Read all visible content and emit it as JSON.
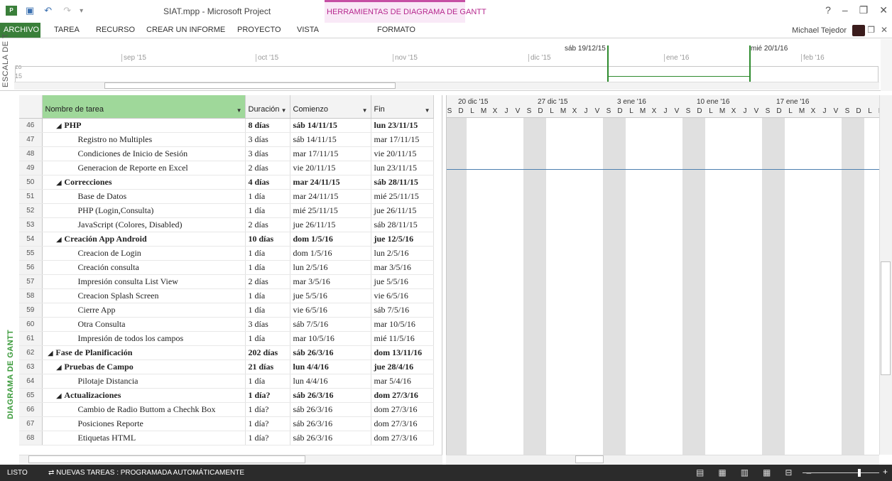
{
  "window": {
    "title": "SIAT.mpp - Microsoft Project",
    "context_tab": "HERRAMIENTAS DE DIAGRAMA DE GANTT",
    "user": "Michael Tejedor"
  },
  "ribbon": {
    "file": "ARCHIVO",
    "tabs": [
      "TAREA",
      "RECURSO",
      "CREAR UN INFORME",
      "PROYECTO",
      "VISTA",
      "FORMATO"
    ]
  },
  "timeline": {
    "side_label": "ESCALA DE T",
    "months": [
      "sep '15",
      "oct '15",
      "nov '15",
      "dic '15",
      "ene '16",
      "feb '16"
    ],
    "markers": [
      "sáb 19/12/15",
      "mié 20/1/16"
    ],
    "small": [
      "zo",
      "15"
    ]
  },
  "view_label": "DIAGRAMA DE GANTT",
  "columns": {
    "name": "Nombre de tarea",
    "duration": "Duración",
    "start": "Comienzo",
    "finish": "Fin"
  },
  "tasks": [
    {
      "id": "46",
      "name": "PHP",
      "dur": "8 días",
      "start": "sáb 14/11/15",
      "end": "lun 23/11/15",
      "summary": true,
      "level": 1
    },
    {
      "id": "47",
      "name": "Registro no Multiples",
      "dur": "3 días",
      "start": "sáb 14/11/15",
      "end": "mar 17/11/15",
      "level": 2
    },
    {
      "id": "48",
      "name": "Condiciones de Inicio de Sesión",
      "dur": "3 días",
      "start": "mar 17/11/15",
      "end": "vie 20/11/15",
      "level": 2
    },
    {
      "id": "49",
      "name": "Generacion de Reporte en Excel",
      "dur": "2 días",
      "start": "vie 20/11/15",
      "end": "lun 23/11/15",
      "level": 2
    },
    {
      "id": "50",
      "name": "Correcciones",
      "dur": "4 días",
      "start": "mar 24/11/15",
      "end": "sáb 28/11/15",
      "summary": true,
      "level": 1
    },
    {
      "id": "51",
      "name": "Base de Datos",
      "dur": "1 día",
      "start": "mar 24/11/15",
      "end": "mié 25/11/15",
      "level": 2
    },
    {
      "id": "52",
      "name": "PHP (Login,Consulta)",
      "dur": "1 día",
      "start": "mié 25/11/15",
      "end": "jue 26/11/15",
      "level": 2
    },
    {
      "id": "53",
      "name": "JavaScript (Colores, Disabled)",
      "dur": "2 días",
      "start": "jue 26/11/15",
      "end": "sáb 28/11/15",
      "level": 2
    },
    {
      "id": "54",
      "name": "Creación App Android",
      "dur": "10 días",
      "start": "dom 1/5/16",
      "end": "jue 12/5/16",
      "summary": true,
      "level": 1
    },
    {
      "id": "55",
      "name": "Creacion de Login",
      "dur": "1 día",
      "start": "dom 1/5/16",
      "end": "lun 2/5/16",
      "level": 2
    },
    {
      "id": "56",
      "name": "Creación consulta",
      "dur": "1 día",
      "start": "lun 2/5/16",
      "end": "mar 3/5/16",
      "level": 2
    },
    {
      "id": "57",
      "name": "Impresión consulta List View",
      "dur": "2 días",
      "start": "mar 3/5/16",
      "end": "jue 5/5/16",
      "level": 2
    },
    {
      "id": "58",
      "name": "Creacion Splash Screen",
      "dur": "1 día",
      "start": "jue 5/5/16",
      "end": "vie 6/5/16",
      "level": 2
    },
    {
      "id": "59",
      "name": "Cierre App",
      "dur": "1 día",
      "start": "vie 6/5/16",
      "end": "sáb 7/5/16",
      "level": 2
    },
    {
      "id": "60",
      "name": "Otra Consulta",
      "dur": "3 días",
      "start": "sáb 7/5/16",
      "end": "mar 10/5/16",
      "level": 2
    },
    {
      "id": "61",
      "name": "Impresión de todos los campos",
      "dur": "1 día",
      "start": "mar 10/5/16",
      "end": "mié 11/5/16",
      "level": 2
    },
    {
      "id": "62",
      "name": "Fase de Planificación",
      "dur": "202 días",
      "start": "sáb 26/3/16",
      "end": "dom 13/11/16",
      "summary": true,
      "level": 0
    },
    {
      "id": "63",
      "name": "Pruebas de Campo",
      "dur": "21 días",
      "start": "lun 4/4/16",
      "end": "jue 28/4/16",
      "summary": true,
      "level": 1
    },
    {
      "id": "64",
      "name": "Pilotaje Distancia",
      "dur": "1 día",
      "start": "lun 4/4/16",
      "end": "mar 5/4/16",
      "level": 2
    },
    {
      "id": "65",
      "name": "Actualizaciones",
      "dur": "1 día?",
      "start": "sáb 26/3/16",
      "end": "dom 27/3/16",
      "summary": true,
      "level": 1
    },
    {
      "id": "66",
      "name": "Cambio de Radio Buttom a Chechk Box",
      "dur": "1 día?",
      "start": "sáb 26/3/16",
      "end": "dom 27/3/16",
      "level": 2
    },
    {
      "id": "67",
      "name": "Posiciones Reporte",
      "dur": "1 día?",
      "start": "sáb 26/3/16",
      "end": "dom 27/3/16",
      "level": 2
    },
    {
      "id": "68",
      "name": "Etiquetas HTML",
      "dur": "1 día?",
      "start": "sáb 26/3/16",
      "end": "dom 27/3/16",
      "level": 2
    }
  ],
  "gantt": {
    "weeks": [
      "20 dic '15",
      "27 dic '15",
      "3 ene '16",
      "10 ene '16",
      "17 ene '16"
    ],
    "days": [
      "S",
      "D",
      "L",
      "M",
      "X",
      "J",
      "V"
    ]
  },
  "status": {
    "ready": "LISTO",
    "new_tasks": "NUEVAS TAREAS : PROGRAMADA AUTOMÁTICAMENTE"
  }
}
